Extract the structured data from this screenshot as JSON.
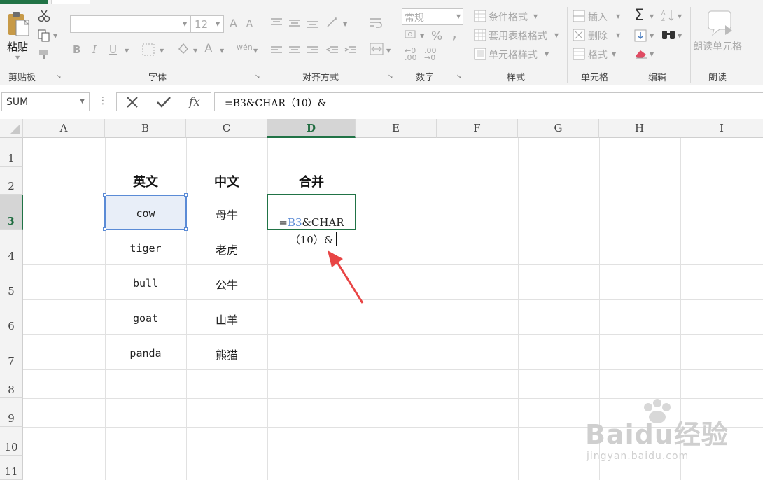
{
  "ribbon": {
    "clipboard": {
      "paste": "粘贴",
      "label": "剪贴板"
    },
    "font": {
      "font_size": "12",
      "label": "字体",
      "bold": "B",
      "italic": "I",
      "underline": "U",
      "font_color": "A",
      "phonetic": "wén",
      "grow": "A",
      "shrink": "A"
    },
    "alignment": {
      "label": "对齐方式"
    },
    "number": {
      "format": "常规",
      "percent": "%",
      "comma": ",",
      "inc_decimal_top": "←0",
      "inc_decimal_bottom": ".00",
      "dec_decimal_top": ".00",
      "dec_decimal_bottom": "→0",
      "label": "数字"
    },
    "styles": {
      "conditional": "条件格式",
      "table": "套用表格格式",
      "cell_styles": "单元格样式",
      "label": "样式"
    },
    "cells": {
      "insert": "插入",
      "delete": "删除",
      "format": "格式",
      "label": "单元格"
    },
    "editing": {
      "sum": "Σ",
      "label": "编辑"
    },
    "speak": {
      "read_cells": "朗读单元格",
      "label": "朗读"
    }
  },
  "formula_bar": {
    "name_box": "SUM",
    "formula": "=B3&CHAR（10）&",
    "more": "⋮"
  },
  "columns": [
    "A",
    "B",
    "C",
    "D",
    "E",
    "F",
    "G",
    "H",
    "I"
  ],
  "rows": [
    "1",
    "2",
    "3",
    "4",
    "5",
    "6",
    "7",
    "8",
    "9",
    "10",
    "11"
  ],
  "cells": {
    "B2": "英文",
    "C2": "中文",
    "D2": "合并",
    "B3": "cow",
    "C3": "母牛",
    "B4": "tiger",
    "C4": "老虎",
    "B5": "bull",
    "C5": "公牛",
    "B6": "goat",
    "C6": "山羊",
    "B7": "panda",
    "C7": "熊猫"
  },
  "edit_cell": {
    "address": "D3",
    "line1_prefix": "=",
    "line1_ref": "B3",
    "line1_rest": "&CHAR",
    "line2": "（10）&"
  },
  "colors": {
    "excel_green": "#217346",
    "ref_blue": "#5b8bd6",
    "arrow_red": "#e84545"
  },
  "watermark": {
    "brand": "Baidu经验",
    "url": "jingyan.baidu.com"
  }
}
